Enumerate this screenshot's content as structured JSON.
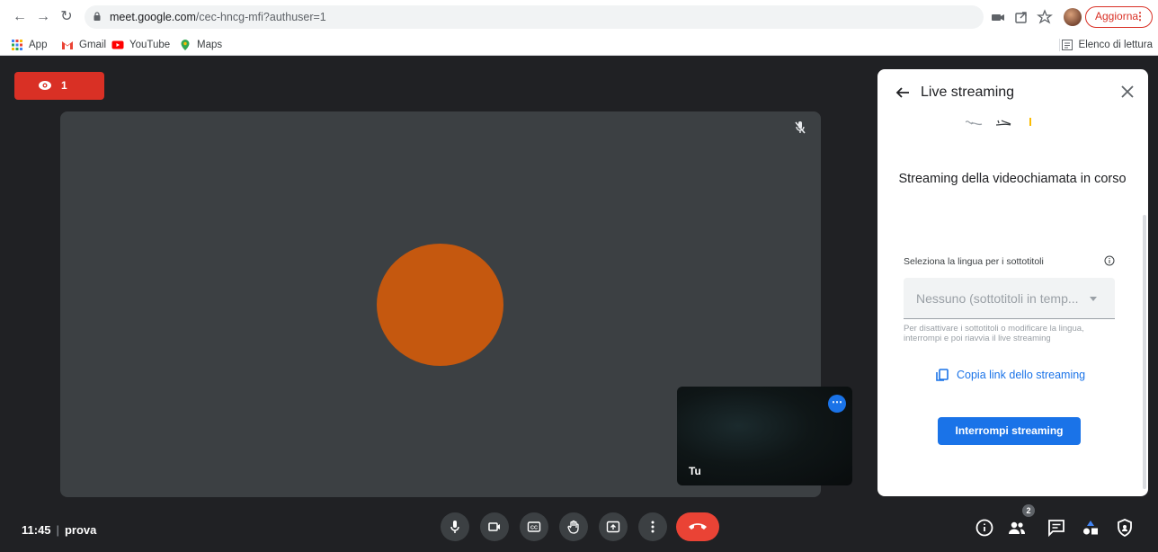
{
  "browser": {
    "url_host": "meet.google.com",
    "url_path": "/cec-hncg-mfi?authuser=1",
    "update_label": "Aggiorna",
    "bookmarks": [
      "App",
      "Gmail",
      "YouTube",
      "Maps"
    ],
    "reading_list_label": "Elenco di lettura"
  },
  "meet": {
    "viewers_count": "1",
    "self_label": "Tu",
    "clock": "11:45",
    "meeting_name": "prova",
    "participants_badge": "2",
    "avatar_color": "#c5580f",
    "accent_color": "#1a73e8",
    "danger_color": "#ea4335"
  },
  "panel": {
    "title": "Live streaming",
    "status": "Streaming della videochiamata in corso",
    "caption_label": "Seleziona la lingua per i sottotitoli",
    "caption_value": "Nessuno (sottotitoli in temp...",
    "helper": "Per disattivare i sottotitoli o modificare la lingua, interrompi e poi riavvia il live streaming",
    "copy_link": "Copia link dello streaming",
    "stop_button": "Interrompi streaming"
  }
}
